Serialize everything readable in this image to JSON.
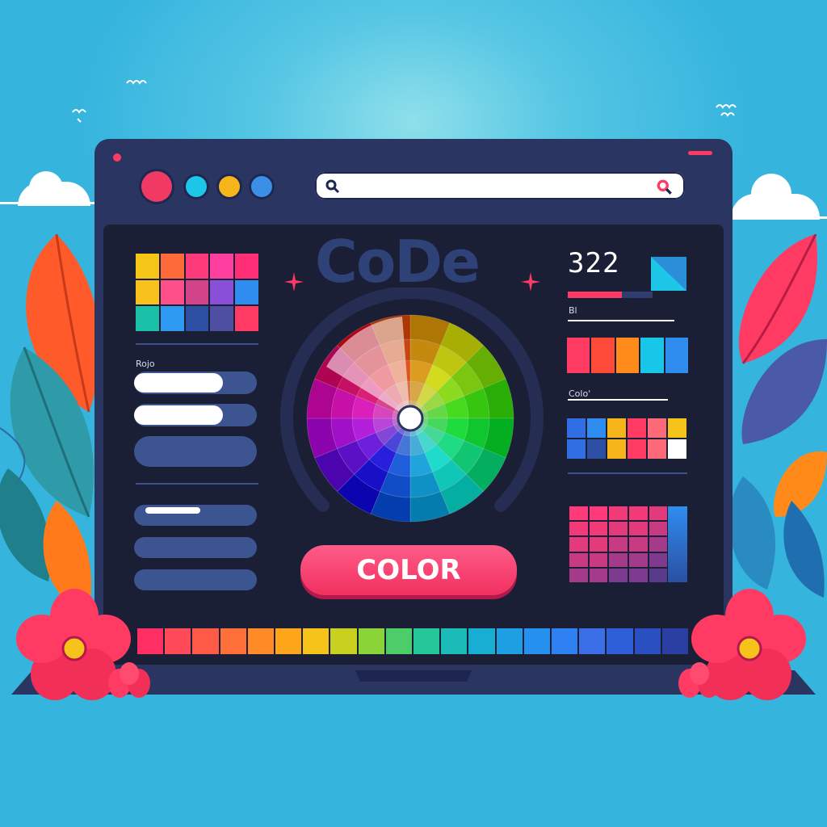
{
  "header": {
    "title": "CoDe",
    "search": {
      "placeholder": ""
    }
  },
  "sidebar": {
    "label": "Rojo"
  },
  "main": {
    "button_label": "COLOR"
  },
  "right_panel": {
    "number": "322",
    "label_1": "Bl",
    "label_2": "Colo'"
  },
  "colors": {
    "accent": "#ff3a63",
    "frame": "#2a3561",
    "screen": "#1a1f36",
    "window_dots": [
      "#f03a63",
      "#1ec7e8",
      "#f6b51a",
      "#3b8fe6"
    ]
  },
  "icons": [
    "search-icon",
    "search-icon-pink",
    "sparkle-icon",
    "color-wheel"
  ],
  "palette_left": [
    "#f5c518",
    "#ff6a3a",
    "#ff3a7a",
    "#ff3fa0",
    "#ff2e77",
    "#f8c11b",
    "#ff4f8b",
    "#d2438a",
    "#8a4fd8",
    "#2f8df0",
    "#1bc0a8",
    "#2e9af2",
    "#2d4fa3",
    "#4e4fa2",
    "#ff3a63"
  ],
  "palette_right_1": [
    "#ff3a63",
    "#ff4a3a",
    "#ff8c1a",
    "#18c6e8",
    "#2f8df0"
  ],
  "palette_right_2": [
    "#2f6fe3",
    "#2f8df0",
    "#f6b51a",
    "#ff3a63",
    "#ff6a7a",
    "#f6c31a",
    "#2f6fe3",
    "#2d4fa3",
    "#f6b51a",
    "#ff3a63",
    "#ff6a7a",
    "#ffffff"
  ],
  "strip": [
    "#ff2e63",
    "#ff4a5a",
    "#ff5a48",
    "#ff6f38",
    "#ff8a26",
    "#ffa51a",
    "#f6c31a",
    "#c8d020",
    "#8ad437",
    "#4ccd6a",
    "#26c699",
    "#1bbcb8",
    "#18aed3",
    "#1f9fe3",
    "#2590ef",
    "#2f80f0",
    "#3a6fe8",
    "#2f5fd8",
    "#2a4fc0",
    "#2b3fa3"
  ]
}
